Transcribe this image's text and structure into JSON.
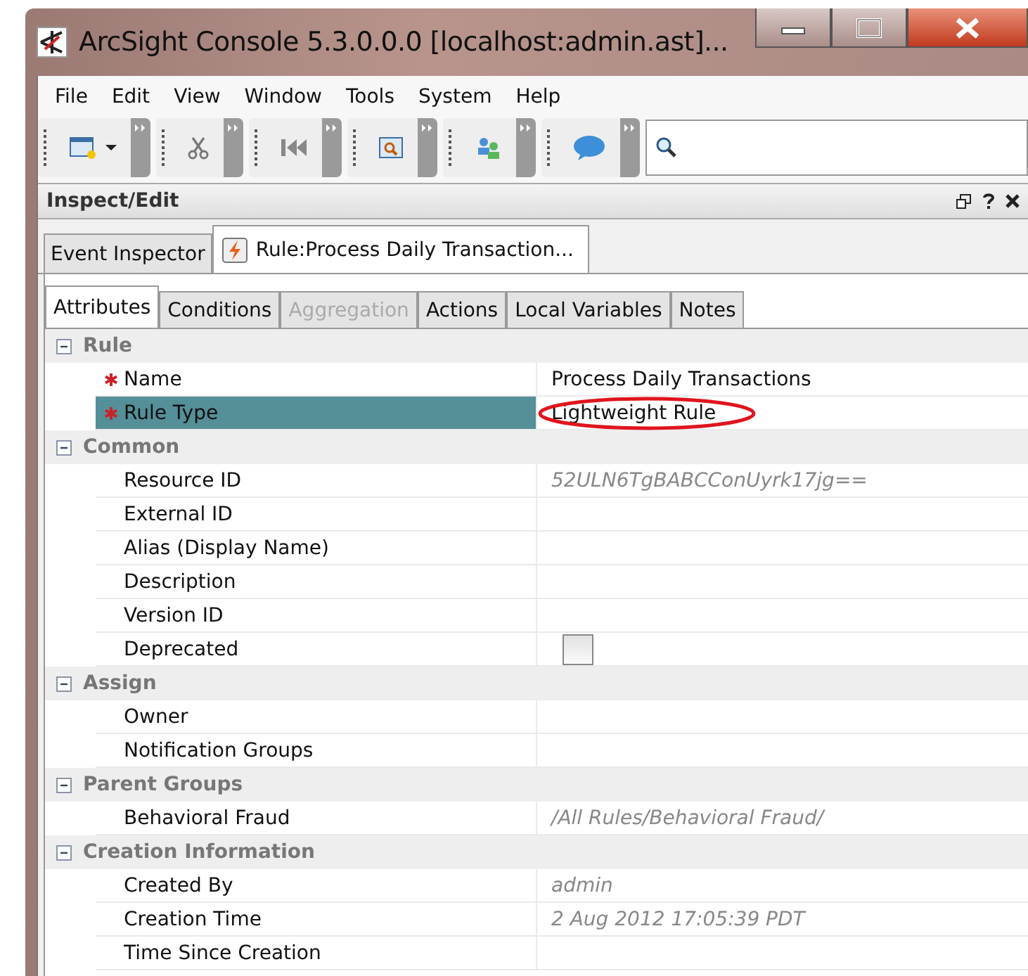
{
  "window": {
    "title": "ArcSight Console 5.3.0.0.0 [localhost:admin.ast]..."
  },
  "menu": [
    "File",
    "Edit",
    "View",
    "Window",
    "Tools",
    "System",
    "Help"
  ],
  "toolbar": {
    "groups": [
      {
        "kind": "new"
      },
      {
        "kind": "cut"
      },
      {
        "kind": "first"
      },
      {
        "kind": "find"
      },
      {
        "kind": "users"
      },
      {
        "kind": "chat"
      }
    ]
  },
  "panel": {
    "title": "Inspect/Edit"
  },
  "tabs": [
    {
      "label": "Event Inspector",
      "selected": false,
      "icon": false
    },
    {
      "label": "Rule:Process Daily Transaction...",
      "selected": true,
      "icon": true
    }
  ],
  "subtabs": [
    {
      "label": "Attributes",
      "selected": true,
      "disabled": false
    },
    {
      "label": "Conditions",
      "selected": false,
      "disabled": false
    },
    {
      "label": "Aggregation",
      "selected": false,
      "disabled": true
    },
    {
      "label": "Actions",
      "selected": false,
      "disabled": false
    },
    {
      "label": "Local Variables",
      "selected": false,
      "disabled": false
    },
    {
      "label": "Notes",
      "selected": false,
      "disabled": false
    }
  ],
  "groups": [
    {
      "title": "Rule",
      "expanded": true,
      "properties": [
        {
          "name": "Name",
          "kind": "text",
          "value": "Process Daily Transactions",
          "required": true,
          "readonly": false,
          "selected": false
        },
        {
          "name": "Rule Type",
          "kind": "text",
          "value": "Lightweight Rule",
          "required": true,
          "readonly": false,
          "selected": true,
          "circled": true
        }
      ]
    },
    {
      "title": "Common",
      "expanded": true,
      "properties": [
        {
          "name": "Resource ID",
          "kind": "text",
          "value": "52ULN6TgBABCConUyrk17jg==",
          "required": false,
          "readonly": true,
          "selected": false
        },
        {
          "name": "External ID",
          "kind": "text",
          "required": false,
          "selected": false
        },
        {
          "name": "Alias (Display Name)",
          "kind": "text",
          "required": false,
          "selected": false
        },
        {
          "name": "Description",
          "kind": "text",
          "required": false,
          "selected": false
        },
        {
          "name": "Version ID",
          "kind": "text",
          "required": false,
          "selected": false
        },
        {
          "name": "Deprecated",
          "kind": "checkbox",
          "checked": false,
          "required": false,
          "selected": false
        }
      ]
    },
    {
      "title": "Assign",
      "expanded": true,
      "properties": [
        {
          "name": "Owner",
          "kind": "text",
          "required": false,
          "selected": false
        },
        {
          "name": "Notification Groups",
          "kind": "text",
          "required": false,
          "selected": false
        }
      ]
    },
    {
      "title": "Parent Groups",
      "expanded": true,
      "properties": [
        {
          "name": "Behavioral Fraud",
          "kind": "text",
          "value": "/All Rules/Behavioral Fraud/",
          "required": false,
          "readonly": true,
          "selected": false
        }
      ]
    },
    {
      "title": "Creation Information",
      "expanded": true,
      "properties": [
        {
          "name": "Created By",
          "kind": "text",
          "value": "admin",
          "required": false,
          "readonly": true,
          "selected": false
        },
        {
          "name": "Creation Time",
          "kind": "text",
          "value": "2 Aug 2012 17:05:39 PDT",
          "required": false,
          "readonly": true,
          "selected": false
        },
        {
          "name": "Time Since Creation",
          "kind": "text",
          "required": false,
          "selected": false
        }
      ]
    }
  ]
}
